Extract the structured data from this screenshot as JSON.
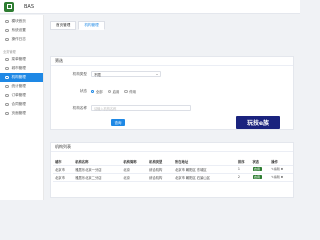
{
  "app": {
    "title": "BAS",
    "brand_color": "#2e7d32",
    "accent_color": "#1e88e5"
  },
  "sidebar": {
    "items_top": [
      {
        "label": "模块首页",
        "icon": "home-icon"
      },
      {
        "label": "系统设置",
        "icon": "settings-icon"
      },
      {
        "label": "操作日志",
        "icon": "log-icon"
      }
    ],
    "group_label": "业务管理",
    "items_group": [
      {
        "label": "菜单管理",
        "icon": "menu-icon",
        "active": false
      },
      {
        "label": "城市管理",
        "icon": "city-icon",
        "active": false
      },
      {
        "label": "机构管理",
        "icon": "org-icon",
        "active": true
      },
      {
        "label": "统计管理",
        "icon": "stats-icon",
        "active": false
      },
      {
        "label": "订单管理",
        "icon": "order-icon",
        "active": false
      },
      {
        "label": "合同管理",
        "icon": "contract-icon",
        "active": false
      },
      {
        "label": "页面管理",
        "icon": "page-icon",
        "active": false
      }
    ]
  },
  "tabs": [
    {
      "label": "首页管理",
      "active": false
    },
    {
      "label": "机构管理",
      "active": true
    }
  ],
  "filter": {
    "title": "筛选",
    "type_label": "机构类型",
    "type_value": "不限",
    "status_label": "状态",
    "status_options": [
      "全部",
      "启用",
      "停用"
    ],
    "status_selected": 0,
    "name_label": "机构名称",
    "name_placeholder": "请输入机构名称",
    "query_label": "查询"
  },
  "watermark": "玩技e族",
  "list": {
    "title": "机构列表",
    "columns": [
      "城市",
      "机构名称",
      "机构简称",
      "机构类型",
      "所在地址",
      "排序",
      "状态",
      "操作"
    ],
    "rows": [
      [
        "北京市",
        "雅居乐北京一分店",
        "北京",
        "综合机构",
        "北京市 朝阳区 东城区",
        "1",
        "启用",
        "✎编辑 ✖"
      ],
      [
        "北京市",
        "雅居乐北京二分店",
        "北京",
        "综合机构",
        "北京市 朝阳区 石景山区",
        "2",
        "启用",
        "✎编辑 ✖"
      ]
    ]
  }
}
